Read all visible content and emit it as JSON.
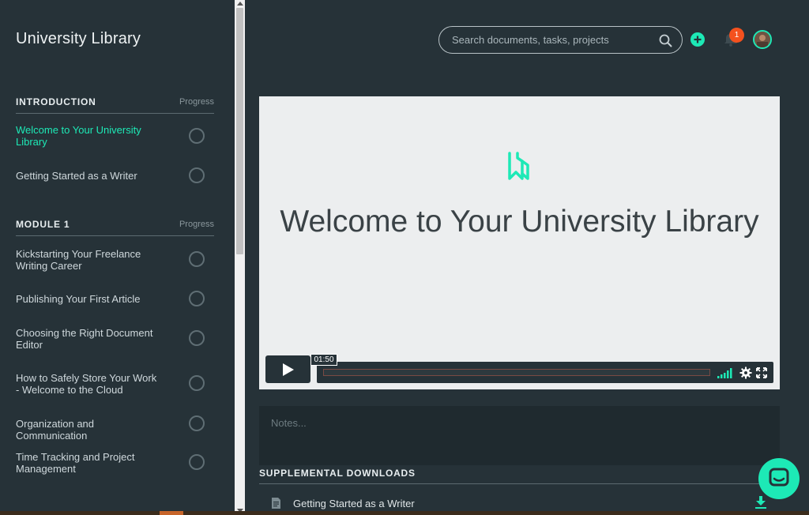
{
  "app": {
    "title": "University Library"
  },
  "sidebar": {
    "sections": [
      {
        "title": "INTRODUCTION",
        "progress_label": "Progress",
        "lessons": [
          {
            "label": "Welcome to Your University Library",
            "active": true
          },
          {
            "label": "Getting Started as a Writer",
            "active": false
          }
        ]
      },
      {
        "title": "MODULE 1",
        "progress_label": "Progress",
        "lessons": [
          {
            "label": "Kickstarting Your Freelance Writing Career",
            "active": false
          },
          {
            "label": "Publishing Your First Article",
            "active": false
          },
          {
            "label": "Choosing the Right Document Editor",
            "active": false
          },
          {
            "label": "How to Safely Store Your Work - Welcome to the Cloud",
            "active": false
          },
          {
            "label": "Organization and Communication",
            "active": false
          },
          {
            "label": "Time Tracking and Project Management",
            "active": false
          }
        ]
      }
    ]
  },
  "header": {
    "search": {
      "placeholder": "Search documents, tasks, projects",
      "value": ""
    },
    "notifications": {
      "count": "1"
    },
    "icons": [
      "search-icon",
      "add-icon",
      "bell-icon",
      "avatar"
    ]
  },
  "video": {
    "title": "Welcome to Your University Library",
    "time_tooltip": "01:50",
    "progress_fraction": 0.0
  },
  "notes": {
    "placeholder": "Notes..."
  },
  "downloads": {
    "title": "SUPPLEMENTAL DOWNLOADS",
    "items": [
      {
        "label": "Getting Started as a Writer"
      }
    ]
  },
  "colors": {
    "accent": "#1de9b6",
    "background": "#263238",
    "badge": "#f4511e",
    "video_bg": "#eceeef"
  }
}
